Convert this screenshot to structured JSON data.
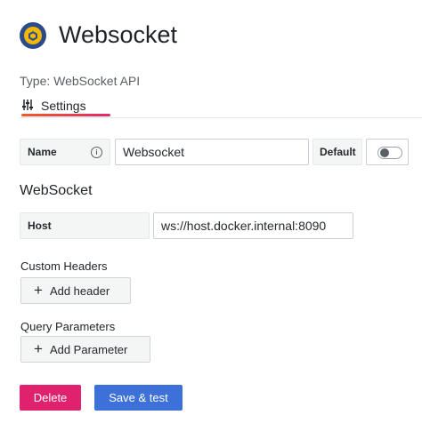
{
  "header": {
    "title": "Websocket",
    "type_line": "Type: WebSocket API",
    "logo_icon": "websocket-plugin-logo"
  },
  "tabs": [
    {
      "label": "Settings",
      "icon": "sliders-icon",
      "active": true
    }
  ],
  "name_row": {
    "label": "Name",
    "value": "Websocket",
    "default_label": "Default",
    "default_enabled": false
  },
  "websocket": {
    "section_title": "WebSocket",
    "host_label": "Host",
    "host_value": "ws://host.docker.internal:8090"
  },
  "custom_headers": {
    "title": "Custom Headers",
    "button_label": "Add header"
  },
  "query_parameters": {
    "title": "Query Parameters",
    "button_label": "Add Parameter"
  },
  "actions": {
    "delete_label": "Delete",
    "save_label": "Save & test"
  },
  "colors": {
    "delete": "#e0226e",
    "save": "#3d71d9",
    "tab_accent_start": "#f05a28",
    "tab_accent_end": "#e02a6c"
  }
}
